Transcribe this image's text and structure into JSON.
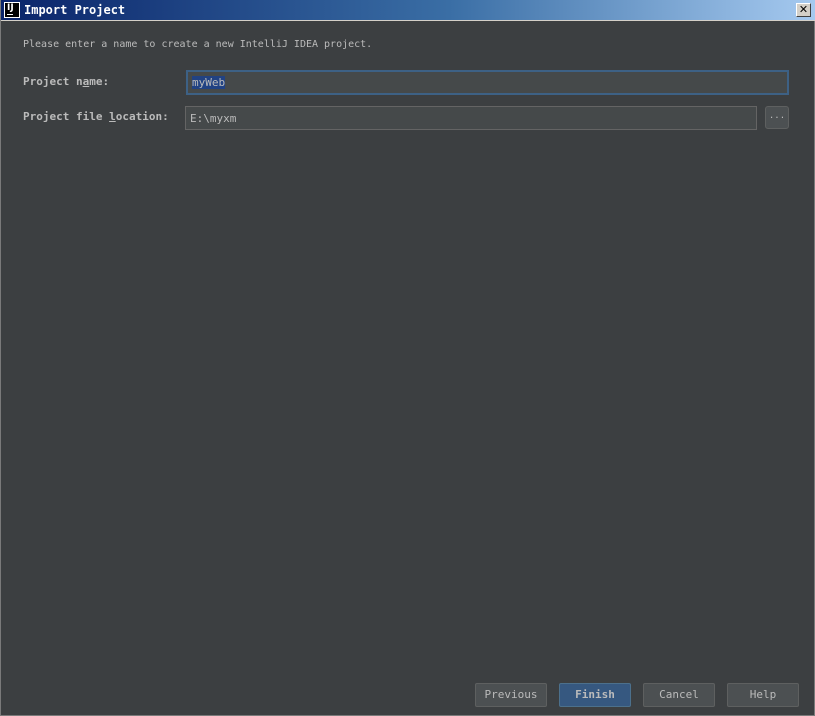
{
  "window": {
    "title": "Import Project",
    "icon_text": "IJ",
    "close_label": "✕"
  },
  "description": "Please enter a name to create a new IntelliJ IDEA project.",
  "form": {
    "project_name": {
      "label_pre": "Project n",
      "label_mnemonic": "a",
      "label_post": "me:",
      "value": "myWeb"
    },
    "project_location": {
      "label_pre": "Project file ",
      "label_mnemonic": "l",
      "label_post": "ocation:",
      "value": "E:\\myxm",
      "browse_label": "..."
    }
  },
  "buttons": {
    "previous": "Previous",
    "finish": "Finish",
    "cancel": "Cancel",
    "help": "Help"
  },
  "colors": {
    "background": "#3c3f41",
    "field_background": "#45494a",
    "focus_border": "#3d6185",
    "default_button": "#365880",
    "text": "#bbbbbb"
  }
}
